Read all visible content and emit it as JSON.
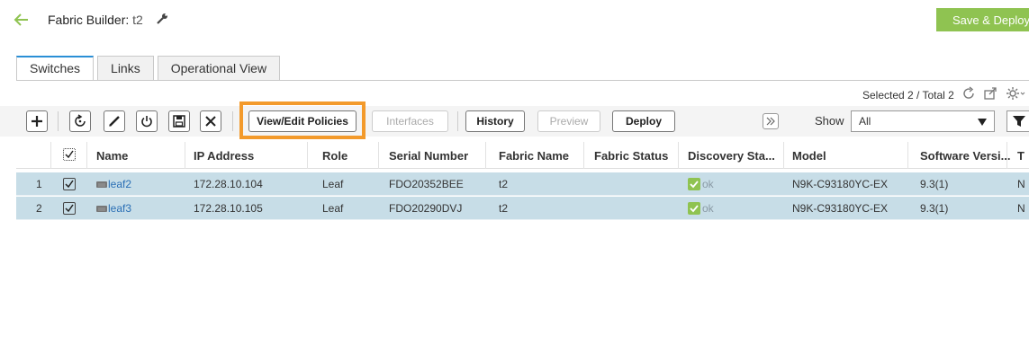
{
  "header": {
    "title_prefix": "Fabric Builder: ",
    "fabric_name": "t2",
    "save_deploy_label": "Save & Deploy"
  },
  "tabs": [
    {
      "label": "Switches",
      "active": true
    },
    {
      "label": "Links",
      "active": false
    },
    {
      "label": "Operational View",
      "active": false
    }
  ],
  "selection": {
    "text": "Selected 2 / Total 2"
  },
  "toolbar": {
    "view_edit_policies": "View/Edit Policies",
    "interfaces": "Interfaces",
    "history": "History",
    "preview": "Preview",
    "deploy": "Deploy",
    "show_label": "Show",
    "show_value": "All"
  },
  "table": {
    "columns": [
      "Name",
      "IP Address",
      "Role",
      "Serial Number",
      "Fabric Name",
      "Fabric Status",
      "Discovery Sta...",
      "Model",
      "Software Versi...",
      "T"
    ],
    "rows": [
      {
        "index": "1",
        "name": "leaf2",
        "ip": "172.28.10.104",
        "role": "Leaf",
        "serial": "FDO20352BEE",
        "fabric": "t2",
        "fabric_status": "",
        "discovery": "ok",
        "model": "N9K-C93180YC-EX",
        "software": "9.3(1)",
        "t": "N"
      },
      {
        "index": "2",
        "name": "leaf3",
        "ip": "172.28.10.105",
        "role": "Leaf",
        "serial": "FDO20290DVJ",
        "fabric": "t2",
        "fabric_status": "",
        "discovery": "ok",
        "model": "N9K-C93180YC-EX",
        "software": "9.3(1)",
        "t": "N"
      }
    ]
  },
  "colors": {
    "accent_green": "#8fc351",
    "tab_blue": "#2a8fd6",
    "highlight_orange": "#f39a2b",
    "row_selected": "#c7dde7",
    "link_blue": "#2a6fb5"
  }
}
